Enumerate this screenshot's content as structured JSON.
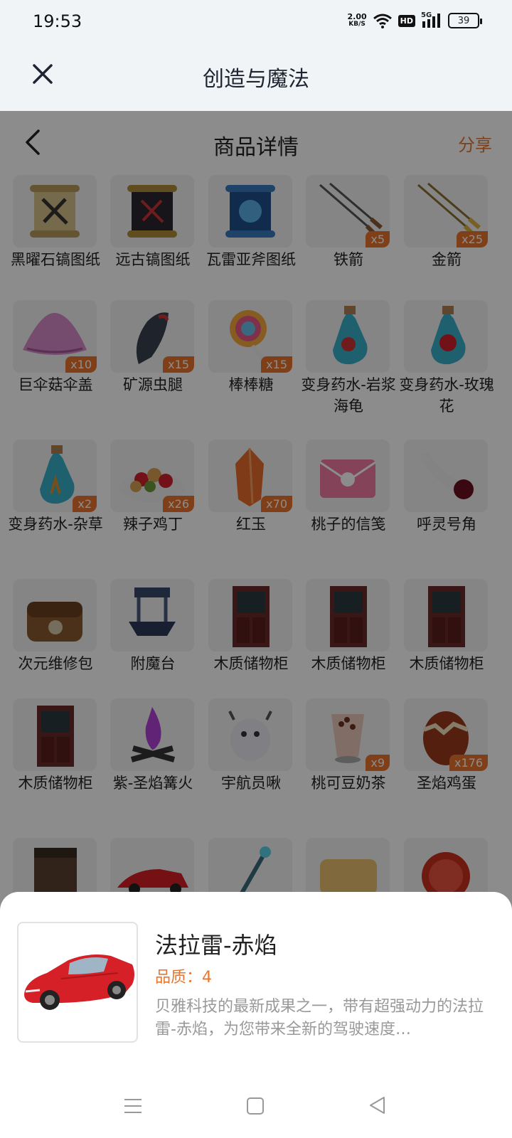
{
  "status": {
    "time": "19:53",
    "speed": "2.00",
    "speed_unit": "KB/S",
    "hd": "HD",
    "network": "5G",
    "battery": "39"
  },
  "header": {
    "title": "创造与魔法",
    "close_icon": "close-icon"
  },
  "subheader": {
    "title": "商品详情",
    "share_label": "分享",
    "back_icon": "back-arrow-icon"
  },
  "items": [
    {
      "label": "黑曜石镐图纸",
      "icon": "scroll-icon",
      "count": ""
    },
    {
      "label": "远古镐图纸",
      "icon": "dark-scroll-icon",
      "count": ""
    },
    {
      "label": "瓦雷亚斧图纸",
      "icon": "blue-scroll-icon",
      "count": ""
    },
    {
      "label": "铁箭",
      "icon": "iron-arrow-icon",
      "count": "x5"
    },
    {
      "label": "金箭",
      "icon": "gold-arrow-icon",
      "count": "x25"
    },
    {
      "label": "巨伞菇伞盖",
      "icon": "mushroom-cap-icon",
      "count": "x10"
    },
    {
      "label": "矿源虫腿",
      "icon": "bug-leg-icon",
      "count": "x15"
    },
    {
      "label": "棒棒糖",
      "icon": "lollipop-icon",
      "count": "x15"
    },
    {
      "label": "变身药水-岩浆海龟",
      "icon": "potion-turtle-icon",
      "count": ""
    },
    {
      "label": "变身药水-玫瑰花",
      "icon": "potion-rose-icon",
      "count": ""
    },
    {
      "label": "变身药水-杂草",
      "icon": "potion-weed-icon",
      "count": "x2"
    },
    {
      "label": "辣子鸡丁",
      "icon": "spicy-chicken-icon",
      "count": "x26"
    },
    {
      "label": "红玉",
      "icon": "red-jade-icon",
      "count": "x70"
    },
    {
      "label": "桃子的信笺",
      "icon": "letter-icon",
      "count": ""
    },
    {
      "label": "呼灵号角",
      "icon": "horn-icon",
      "count": ""
    },
    {
      "label": "次元维修包",
      "icon": "repair-bag-icon",
      "count": ""
    },
    {
      "label": "附魔台",
      "icon": "enchant-table-icon",
      "count": ""
    },
    {
      "label": "木质储物柜",
      "icon": "cabinet-icon",
      "count": ""
    },
    {
      "label": "木质储物柜",
      "icon": "cabinet-icon",
      "count": ""
    },
    {
      "label": "木质储物柜",
      "icon": "cabinet-icon",
      "count": ""
    },
    {
      "label": "木质储物柜",
      "icon": "cabinet-icon",
      "count": ""
    },
    {
      "label": "紫-圣焰篝火",
      "icon": "purple-bonfire-icon",
      "count": ""
    },
    {
      "label": "宇航员啾",
      "icon": "astronaut-pet-icon",
      "count": ""
    },
    {
      "label": "桃可豆奶茶",
      "icon": "milk-tea-icon",
      "count": "x9"
    },
    {
      "label": "圣焰鸡蛋",
      "icon": "egg-icon",
      "count": "x176"
    },
    {
      "label": "",
      "icon": "chest-icon",
      "count": ""
    },
    {
      "label": "",
      "icon": "car-icon",
      "count": ""
    },
    {
      "label": "",
      "icon": "staff-icon",
      "count": ""
    },
    {
      "label": "",
      "icon": "sign-icon",
      "count": ""
    },
    {
      "label": "",
      "icon": "red-orb-icon",
      "count": ""
    }
  ],
  "product": {
    "name": "法拉雷-赤焰",
    "quality": "品质：4",
    "description": "贝雅科技的最新成果之一，带有超强动力的法拉雷-赤焰，为您带来全新的驾驶速度…",
    "image_icon": "red-sports-car-icon"
  },
  "navbar": {
    "menu_icon": "menu-icon",
    "home_icon": "home-icon",
    "back_icon": "back-triangle-icon"
  },
  "colors": {
    "accent": "#e8762e",
    "header_bg": "#f1f4f7",
    "badge": "#e8762e"
  }
}
